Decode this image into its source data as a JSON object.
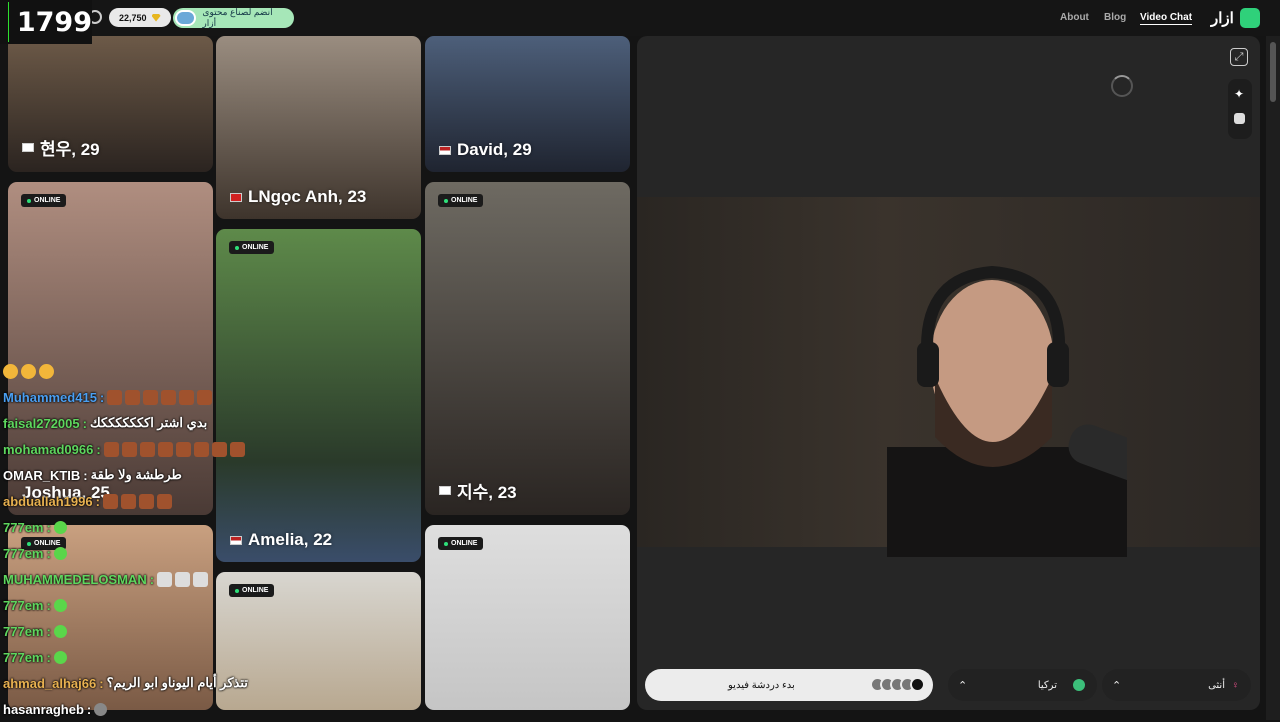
{
  "overlay": {
    "counter": "1799"
  },
  "header": {
    "coins": "22,750",
    "join_label": "انضم لصناع محتوى أزار",
    "nav": [
      "About",
      "Blog",
      "Video Chat"
    ],
    "brand": "ازار"
  },
  "cards": [
    {
      "name": "현우, 29",
      "online": ""
    },
    {
      "name": "LNgọc Anh, 23",
      "online": ""
    },
    {
      "name": "David, 29",
      "online": ""
    },
    {
      "name": "Joshua, 25",
      "online": "ONLINE"
    },
    {
      "name": "Amelia, 22",
      "online": "ONLINE"
    },
    {
      "name": "지수, 23",
      "online": "ONLINE"
    },
    {
      "name": "",
      "online": "ONLINE"
    },
    {
      "name": "",
      "online": "ONLINE"
    },
    {
      "name": "",
      "online": "ONLINE"
    }
  ],
  "controls": {
    "start_chat": "بدء دردشة فيديو",
    "country": "تركيا",
    "gender": "أنثى"
  },
  "chat": [
    {
      "user": "Muhammed415",
      "sep": ":",
      "text": ""
    },
    {
      "user": "faisal272005",
      "sep": ":",
      "text": "بدي اشتر اكككككككك"
    },
    {
      "user": "mohamad0966",
      "sep": ":",
      "text": ""
    },
    {
      "user": "OMAR_KTIB",
      "sep": ":",
      "text": "طرطشة ولا طقة"
    },
    {
      "user": "abduallah1996",
      "sep": ":",
      "text": ""
    },
    {
      "user": "777em",
      "sep": ":",
      "text": ""
    },
    {
      "user": "777em",
      "sep": ":",
      "text": ""
    },
    {
      "user": "MUHAMMEDELOSMAN",
      "sep": ":",
      "text": ""
    },
    {
      "user": "777em",
      "sep": ":",
      "text": ""
    },
    {
      "user": "777em",
      "sep": ":",
      "text": ""
    },
    {
      "user": "777em",
      "sep": ":",
      "text": ""
    },
    {
      "user": "ahmad_alhaj66",
      "sep": ":",
      "text": "تتذكر أيام اليوناو ابو الريم؟"
    },
    {
      "user": "hasanragheb",
      "sep": ":",
      "text": ""
    }
  ]
}
